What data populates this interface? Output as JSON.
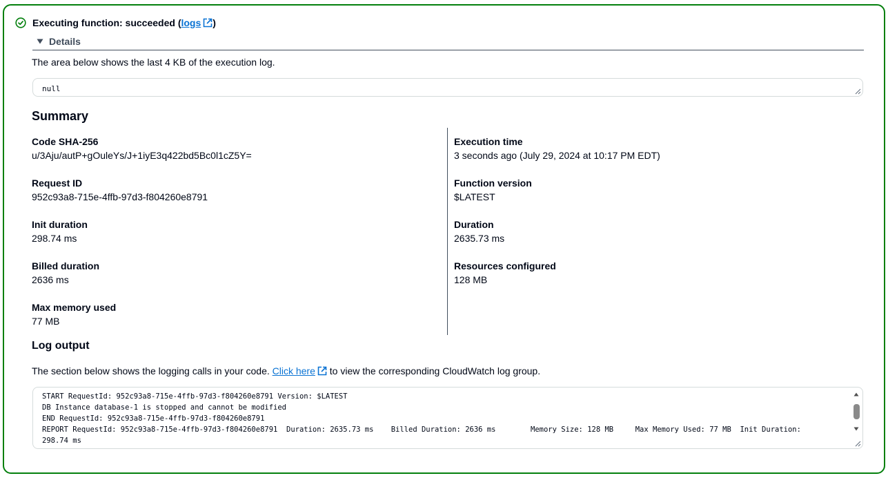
{
  "header": {
    "status_text": "Executing function: succeeded (",
    "logs_link": "logs",
    "close_paren": ")"
  },
  "details": {
    "label": "Details"
  },
  "execution_log": {
    "description": "The area below shows the last 4 KB of the execution log.",
    "value": "null"
  },
  "summary": {
    "title": "Summary",
    "left": [
      {
        "label": "Code SHA-256",
        "value": "u/3Aju/autP+gOuleYs/J+1iyE3q422bd5Bc0l1cZ5Y="
      },
      {
        "label": "Request ID",
        "value": "952c93a8-715e-4ffb-97d3-f804260e8791"
      },
      {
        "label": "Init duration",
        "value": "298.74 ms"
      },
      {
        "label": "Billed duration",
        "value": "2636 ms"
      },
      {
        "label": "Max memory used",
        "value": "77 MB"
      }
    ],
    "right": [
      {
        "label": "Execution time",
        "value": "3 seconds ago (July 29, 2024 at 10:17 PM EDT)"
      },
      {
        "label": "Function version",
        "value": "$LATEST"
      },
      {
        "label": "Duration",
        "value": "2635.73 ms"
      },
      {
        "label": "Resources configured",
        "value": "128 MB"
      }
    ]
  },
  "log_output": {
    "title": "Log output",
    "desc_before": "The section below shows the logging calls in your code. ",
    "link": "Click here",
    "desc_after": " to view the corresponding CloudWatch log group.",
    "lines": [
      "START RequestId: 952c93a8-715e-4ffb-97d3-f804260e8791 Version: $LATEST",
      "DB Instance database-1 is stopped and cannot be modified",
      "END RequestId: 952c93a8-715e-4ffb-97d3-f804260e8791",
      "REPORT RequestId: 952c93a8-715e-4ffb-97d3-f804260e8791  Duration: 2635.73 ms    Billed Duration: 2636 ms        Memory Size: 128 MB     Max Memory Used: 77 MB  Init Duration:",
      "298.74 ms"
    ]
  },
  "colors": {
    "success": "#037f0c",
    "link": "#0972d3",
    "text": "#000716"
  }
}
